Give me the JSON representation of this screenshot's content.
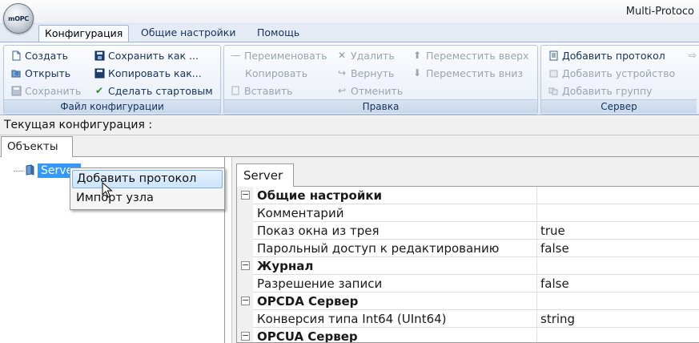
{
  "window": {
    "logo_text": "mOPC",
    "title": "Multi-Protoco"
  },
  "ribbon_tabs": [
    {
      "label": "Конфигурация",
      "active": true
    },
    {
      "label": "Общие настройки",
      "active": false
    },
    {
      "label": "Помощь",
      "active": false
    }
  ],
  "ribbon": {
    "file_group": {
      "label": "Файл конфигурации",
      "create": "Создать",
      "open": "Открыть",
      "save": "Сохранить",
      "save_as": "Сохранить как ...",
      "copy_as": "Копировать как...",
      "make_startup": "Сделать стартовым"
    },
    "edit_group": {
      "label": "Правка",
      "rename": "Переименовать",
      "copy": "Копировать",
      "paste": "Вставить",
      "delete": "Удалить",
      "redo": "Вернуть",
      "undo": "Отменить",
      "move_up": "Переместить вверх",
      "move_down": "Переместить вниз"
    },
    "server_group": {
      "label": "Сервер",
      "add_protocol": "Добавить протокол",
      "add_device": "Добавить устройство",
      "add_group": "Добавить группу"
    }
  },
  "current_config": {
    "label": "Текущая конфигурация :"
  },
  "objects_tab": {
    "label": "Объекты"
  },
  "tree": {
    "node": "Server"
  },
  "context_menu": {
    "items": [
      "Добавить протокол",
      "Импорт узла"
    ]
  },
  "properties": {
    "tab": "Server",
    "rows": [
      {
        "name": "Общие настройки",
        "value": "",
        "category": true
      },
      {
        "name": "Комментарий",
        "value": ""
      },
      {
        "name": "Показ окна из трея",
        "value": "true"
      },
      {
        "name": "Парольный доступ к редактированию",
        "value": "false"
      },
      {
        "name": "Журнал",
        "value": "",
        "category": true
      },
      {
        "name": "Разрешение записи",
        "value": "false"
      },
      {
        "name": "OPCDA Сервер",
        "value": "",
        "category": true
      },
      {
        "name": "Конверсия типа Int64 (UInt64)",
        "value": "string"
      },
      {
        "name": "OPCUA Сервер",
        "value": "",
        "category": true
      }
    ]
  },
  "colors": {
    "selection": "#3399ff",
    "ribbon_text": "#15325c",
    "disabled_text": "#9aa4b1"
  }
}
